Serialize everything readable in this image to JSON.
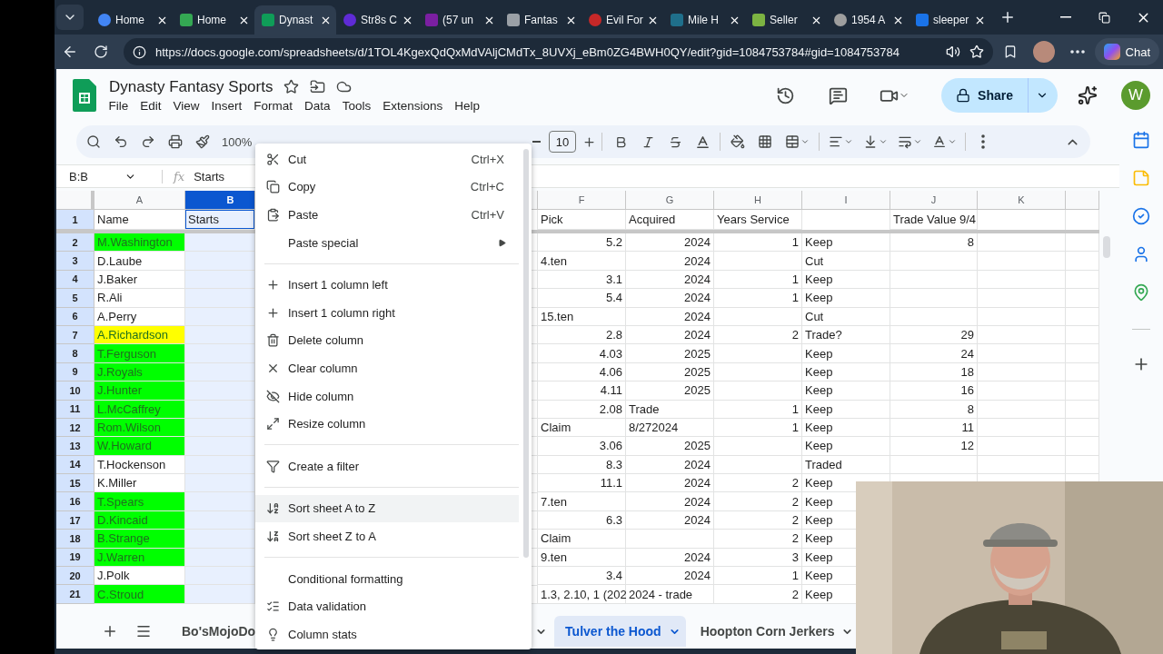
{
  "browser": {
    "tabs": [
      {
        "title": "Home",
        "selected": false
      },
      {
        "title": "Home",
        "selected": false
      },
      {
        "title": "Dynast",
        "selected": true
      },
      {
        "title": "Str8s C",
        "selected": false
      },
      {
        "title": "(57 un",
        "selected": false
      },
      {
        "title": "Fantas",
        "selected": false
      },
      {
        "title": "Evil For",
        "selected": false
      },
      {
        "title": "Mile H",
        "selected": false
      },
      {
        "title": "Seller",
        "selected": false
      },
      {
        "title": "1954 A",
        "selected": false
      },
      {
        "title": "sleeper",
        "selected": false
      }
    ],
    "url": "https://docs.google.com/spreadsheets/d/1TOL4KgexQdQxMdVAljCMdTx_8UVXj_eBm0ZG4BWH0QY/edit?gid=1084753784#gid=1084753784",
    "chat_label": "Chat"
  },
  "doc": {
    "title": "Dynasty Fantasy Sports",
    "menus": [
      "File",
      "Edit",
      "View",
      "Insert",
      "Format",
      "Data",
      "Tools",
      "Extensions",
      "Help"
    ],
    "share_label": "Share",
    "avatar_letter": "W"
  },
  "toolbar": {
    "zoom": "100%",
    "font_size": "10"
  },
  "formula_bar": {
    "range": "B:B",
    "function_symbol": "fx",
    "content": "Starts"
  },
  "columns": [
    {
      "letter": "A",
      "selected": false
    },
    {
      "letter": "B",
      "selected": true
    },
    {
      "letter": "F",
      "selected": false
    },
    {
      "letter": "G",
      "selected": false
    },
    {
      "letter": "H",
      "selected": false
    },
    {
      "letter": "I",
      "selected": false
    },
    {
      "letter": "J",
      "selected": false
    },
    {
      "letter": "K",
      "selected": false
    }
  ],
  "header_row": {
    "number": "1",
    "name": "Name",
    "starts": "Starts",
    "pick": "Pick",
    "acquired": "Acquired",
    "years": "Years Service",
    "trade_value": "Trade Value 9/4"
  },
  "rows": [
    {
      "number": "2",
      "name": "M.Washington",
      "color": "#00ff00",
      "pick": "5.2",
      "acquired": "2024",
      "years": "1",
      "status": "Keep",
      "trade_value": "8"
    },
    {
      "number": "3",
      "name": "D.Laube",
      "pick": "4.ten",
      "acquired": "2024",
      "status": "Cut"
    },
    {
      "number": "4",
      "name": "J.Baker",
      "pick": "3.1",
      "acquired": "2024",
      "years": "1",
      "status": "Keep"
    },
    {
      "number": "5",
      "name": "R.Ali",
      "pick": "5.4",
      "acquired": "2024",
      "years": "1",
      "status": "Keep"
    },
    {
      "number": "6",
      "name": "A.Perry",
      "pick": "15.ten",
      "acquired": "2024",
      "status": "Cut"
    },
    {
      "number": "7",
      "name": "A.Richardson",
      "color": "#ffff00",
      "pick": "2.8",
      "acquired": "2024",
      "years": "2",
      "status": "Trade?",
      "trade_value": "29"
    },
    {
      "number": "8",
      "name": "T.Ferguson",
      "color": "#00ff00",
      "pick": "4.03",
      "acquired": "2025",
      "status": "Keep",
      "trade_value": "24"
    },
    {
      "number": "9",
      "name": "J.Royals",
      "color": "#00ff00",
      "pick": "4.06",
      "acquired": "2025",
      "status": "Keep",
      "trade_value": "18"
    },
    {
      "number": "10",
      "name": "J.Hunter",
      "color": "#00ff00",
      "pick": "4.11",
      "acquired": "2025",
      "status": "Keep",
      "trade_value": "16"
    },
    {
      "number": "11",
      "name": "L.McCaffrey",
      "color": "#00ff00",
      "pick": "2.08",
      "acquired": "Trade",
      "years": "1",
      "status": "Keep",
      "trade_value": "8"
    },
    {
      "number": "12",
      "name": "Rom.Wilson",
      "color": "#00ff00",
      "pick": "Claim",
      "acquired": "8/272024",
      "years": "1",
      "status": "Keep",
      "trade_value": "11"
    },
    {
      "number": "13",
      "name": "W.Howard",
      "color": "#00ff00",
      "pick": "3.06",
      "acquired": "2025",
      "status": "Keep",
      "trade_value": "12"
    },
    {
      "number": "14",
      "name": "T.Hockenson",
      "pick": "8.3",
      "acquired": "2024",
      "status": "Traded"
    },
    {
      "number": "15",
      "name": "K.Miller",
      "pick": "11.1",
      "acquired": "2024",
      "years": "2",
      "status": "Keep"
    },
    {
      "number": "16",
      "name": "T.Spears",
      "color": "#00ff00",
      "pick": "7.ten",
      "acquired": "2024",
      "years": "2",
      "status": "Keep"
    },
    {
      "number": "17",
      "name": "D.Kincaid",
      "color": "#00ff00",
      "pick": "6.3",
      "acquired": "2024",
      "years": "2",
      "status": "Keep"
    },
    {
      "number": "18",
      "name": "B.Strange",
      "color": "#00ff00",
      "pick": "Claim",
      "years": "2",
      "status": "Keep"
    },
    {
      "number": "19",
      "name": "J.Warren",
      "color": "#00ff00",
      "pick": "9.ten",
      "acquired": "2024",
      "years": "3",
      "status": "Keep"
    },
    {
      "number": "20",
      "name": "J.Polk",
      "pick": "3.4",
      "acquired": "2024",
      "years": "1",
      "status": "Keep"
    },
    {
      "number": "21",
      "name": "C.Stroud",
      "color": "#00ff00",
      "pick": "1.3, 2.10, 1 (202",
      "acquired": "2024 - trade",
      "years": "2",
      "status": "Keep"
    }
  ],
  "context_menu": {
    "sections": [
      [
        {
          "label": "Cut",
          "shortcut": "Ctrl+X",
          "submenu": false,
          "highlighted": false
        },
        {
          "label": "Copy",
          "shortcut": "Ctrl+C",
          "submenu": false,
          "highlighted": false
        },
        {
          "label": "Paste",
          "shortcut": "Ctrl+V",
          "submenu": false,
          "highlighted": false
        },
        {
          "label": "Paste special",
          "submenu": true,
          "highlighted": false
        }
      ],
      [
        {
          "label": "Insert 1 column left",
          "submenu": false,
          "highlighted": false
        },
        {
          "label": "Insert 1 column right",
          "submenu": false,
          "highlighted": false
        },
        {
          "label": "Delete column",
          "submenu": false,
          "highlighted": false
        },
        {
          "label": "Clear column",
          "submenu": false,
          "highlighted": false
        },
        {
          "label": "Hide column",
          "submenu": false,
          "highlighted": false
        },
        {
          "label": "Resize column",
          "submenu": false,
          "highlighted": false
        }
      ],
      [
        {
          "label": "Create a filter",
          "submenu": false,
          "highlighted": false
        }
      ],
      [
        {
          "label": "Sort sheet A to Z",
          "submenu": false,
          "highlighted": true
        },
        {
          "label": "Sort sheet Z to A",
          "submenu": false,
          "highlighted": false
        }
      ],
      [
        {
          "label": "Conditional formatting",
          "submenu": false,
          "highlighted": false
        },
        {
          "label": "Data validation",
          "submenu": false,
          "highlighted": false
        },
        {
          "label": "Column stats",
          "submenu": false,
          "highlighted": false
        }
      ]
    ]
  },
  "sheet_tabs": [
    {
      "label": "Bo'sMojoDo",
      "selected": false
    },
    {
      "label": "Tulver the Hood",
      "selected": true
    },
    {
      "label": "Hoopton Corn Jerkers",
      "selected": false
    }
  ]
}
